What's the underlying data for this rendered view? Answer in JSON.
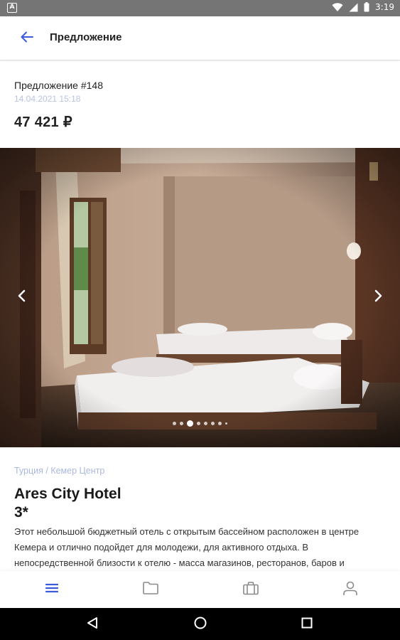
{
  "status_bar": {
    "time": "3:19",
    "left_badge": "A",
    "icons": [
      "wifi-icon",
      "signal-icon",
      "battery-icon"
    ]
  },
  "app_bar": {
    "title": "Предложение",
    "back_icon": "arrow-left-icon"
  },
  "offer": {
    "number": "Предложение #148",
    "date": "14.04.2021 15:18",
    "price": "47 421 ₽"
  },
  "gallery": {
    "image_count": 8,
    "active_index": 2,
    "prev_icon": "chevron-left-icon",
    "next_icon": "chevron-right-icon"
  },
  "hotel": {
    "location": "Турция / Кемер Центр",
    "name": "Ares City Hotel",
    "stars": "3*",
    "description": "Этот небольшой бюджетный отель с открытым бассейном расположен в центре Кемера и отлично подойдет для молодежи, для активного отдыха. В непосредственной близости к отелю - масса магазинов, ресторанов, баров и"
  },
  "bottom_nav": [
    {
      "name": "menu",
      "icon": "menu-icon",
      "active": true
    },
    {
      "name": "folder",
      "icon": "folder-icon",
      "active": false
    },
    {
      "name": "briefcase",
      "icon": "briefcase-icon",
      "active": false
    },
    {
      "name": "profile",
      "icon": "user-icon",
      "active": false
    }
  ],
  "colors": {
    "accent": "#3b5bdb",
    "date_text": "#b8c4e0",
    "location_text": "#aab8de",
    "nav_inactive": "#8a8a8a"
  }
}
